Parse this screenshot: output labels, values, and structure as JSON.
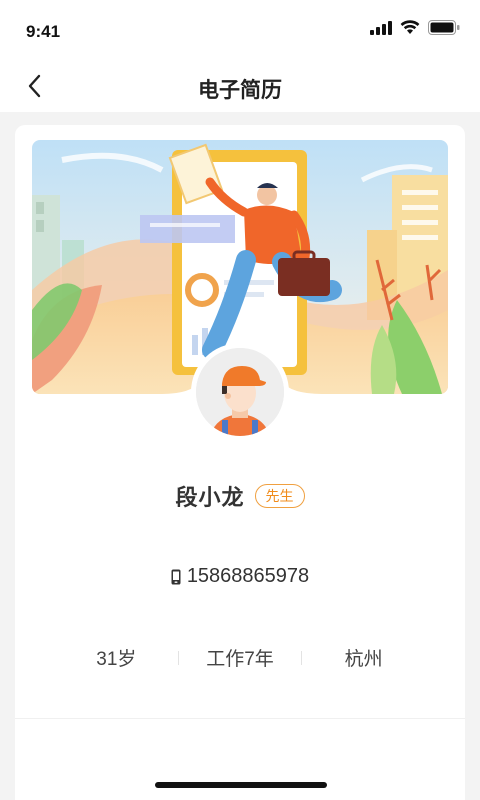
{
  "status_bar": {
    "time": "9:41"
  },
  "nav": {
    "title": "电子简历"
  },
  "profile": {
    "name": "段小龙",
    "gender_label": "先生",
    "phone": "15868865978",
    "age": "31岁",
    "experience": "工作7年",
    "city": "杭州"
  },
  "colors": {
    "accent": "#f08c1c",
    "banner_sky": "#d6ecf8",
    "banner_ground": "#fbd8a5"
  },
  "icons": {
    "back": "chevron-left-icon",
    "phone": "mobile-phone-icon",
    "signal": "signal-icon",
    "wifi": "wifi-icon",
    "battery": "battery-icon"
  }
}
